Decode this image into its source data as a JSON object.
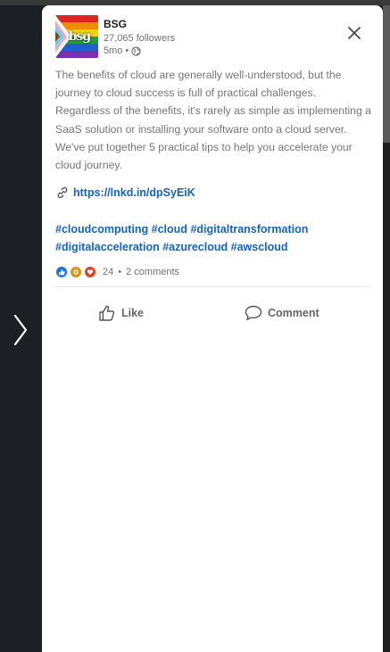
{
  "nav": {
    "next_icon": "chevron-right-icon"
  },
  "post": {
    "author": {
      "name": "BSG",
      "logo_text": "bsg",
      "followers": "27,065 followers",
      "time": "5mo",
      "separator": "•",
      "visibility_icon": "globe-icon"
    },
    "close_icon": "close-icon",
    "body": "The benefits of cloud are generally well-understood, but the journey to cloud success is full of practical challenges. Regardless of the benefits, it's rarely as simple as implementing a SaaS solution or installing your software onto a cloud server. We've put together 5 practical tips to help you accelerate your cloud journey.",
    "link": {
      "icon": "link-icon",
      "text": "https://lnkd.in/dpSyEiK"
    },
    "hashtags": [
      "#cloudcomputing",
      "#cloud",
      "#digitaltransformation",
      "#digitalacceleration",
      "#azurecloud",
      "#awscloud"
    ],
    "reactions": {
      "icons": [
        "like-reaction-icon",
        "support-reaction-icon",
        "love-reaction-icon"
      ],
      "count": "24",
      "separator": "•",
      "comments": "2 comments"
    },
    "actions": {
      "like_label": "Like",
      "comment_label": "Comment"
    }
  },
  "colors": {
    "link": "#1464c0",
    "like_reaction": "#1a73e8",
    "support_reaction": "#d9941e",
    "love_reaction": "#d6452b",
    "logo_stripes": [
      "#e02424",
      "#f08c00",
      "#f2d200",
      "#1f9d3a",
      "#1f5fd0",
      "#7a2fb3"
    ]
  }
}
